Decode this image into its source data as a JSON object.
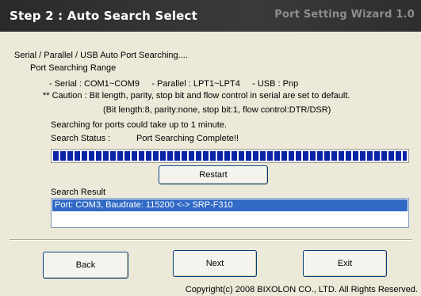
{
  "header": {
    "title": "Step 2 : Auto Search Select",
    "wizard_name": "Port Setting Wizard 1.0"
  },
  "main": {
    "heading": "Serial / Parallel / USB Auto Port Searching....",
    "range_label": "Port Searching Range",
    "range_line": "- Serial : COM1~COM9     - Parallel : LPT1~LPT4     - USB : Pnp",
    "caution_line": "** Caution : Bit length, parity, stop bit and flow control in serial are set to default.",
    "defaults_line": "(Bit length:8, parity:none, stop bit:1, flow control:DTR/DSR)",
    "duration_note": "Searching for ports could take up to 1 minute.",
    "status_label": "Search Status :",
    "status_value": "Port Searching Complete!!",
    "progress": 1.0,
    "restart_label": "Restart",
    "result_label": "Search Result",
    "results": [
      "Port: COM3, Baudrate: 115200 <-> SRP-F310"
    ]
  },
  "footer": {
    "back_label": "Back",
    "next_label": "Next",
    "exit_label": "Exit",
    "copyright": "Copyright(c) 2008 BIXOLON CO., LTD. All Rights Reserved."
  },
  "colors": {
    "header_bg": "#2c2c2c",
    "progress_fill": "#0a24a6",
    "selection": "#316ac5",
    "window_bg": "#ece9d8"
  }
}
